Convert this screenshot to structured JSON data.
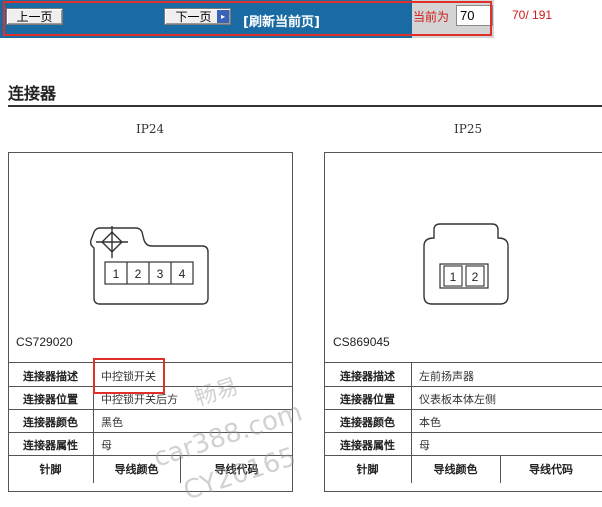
{
  "nav": {
    "prev_label": "上一页",
    "next_label": "下一页",
    "next_arrow": "▸",
    "refresh_label": "[刷新当前页]",
    "current_label": "当前为",
    "page_value": "70",
    "page_count": "70/ 191"
  },
  "section": {
    "title": "连接器"
  },
  "connectors": [
    {
      "id": "IP24",
      "code": "CS729020",
      "pins": [
        "1",
        "2",
        "3",
        "4"
      ],
      "rows": [
        {
          "label": "连接器描述",
          "value": "中控锁开关"
        },
        {
          "label": "连接器位置",
          "value": "中控锁开关后方"
        },
        {
          "label": "连接器颜色",
          "value": "黑色"
        },
        {
          "label": "连接器属性",
          "value": "母"
        }
      ],
      "headers": [
        "针脚",
        "导线颜色",
        "导线代码"
      ]
    },
    {
      "id": "IP25",
      "code": "CS869045",
      "pins": [
        "1",
        "2"
      ],
      "rows": [
        {
          "label": "连接器描述",
          "value": "左前扬声器"
        },
        {
          "label": "连接器位置",
          "value": "仪表板本体左侧"
        },
        {
          "label": "连接器颜色",
          "value": "本色"
        },
        {
          "label": "连接器属性",
          "value": "母"
        }
      ],
      "headers": [
        "针脚",
        "导线颜色",
        "导线代码"
      ]
    }
  ],
  "watermark": {
    "line1": "畅易",
    "line2": "car388.com",
    "line3": "CY20165"
  },
  "colors": {
    "nav_bg": "#1a6ba3",
    "highlight": "#e0302a",
    "counter_text": "#d01818"
  }
}
